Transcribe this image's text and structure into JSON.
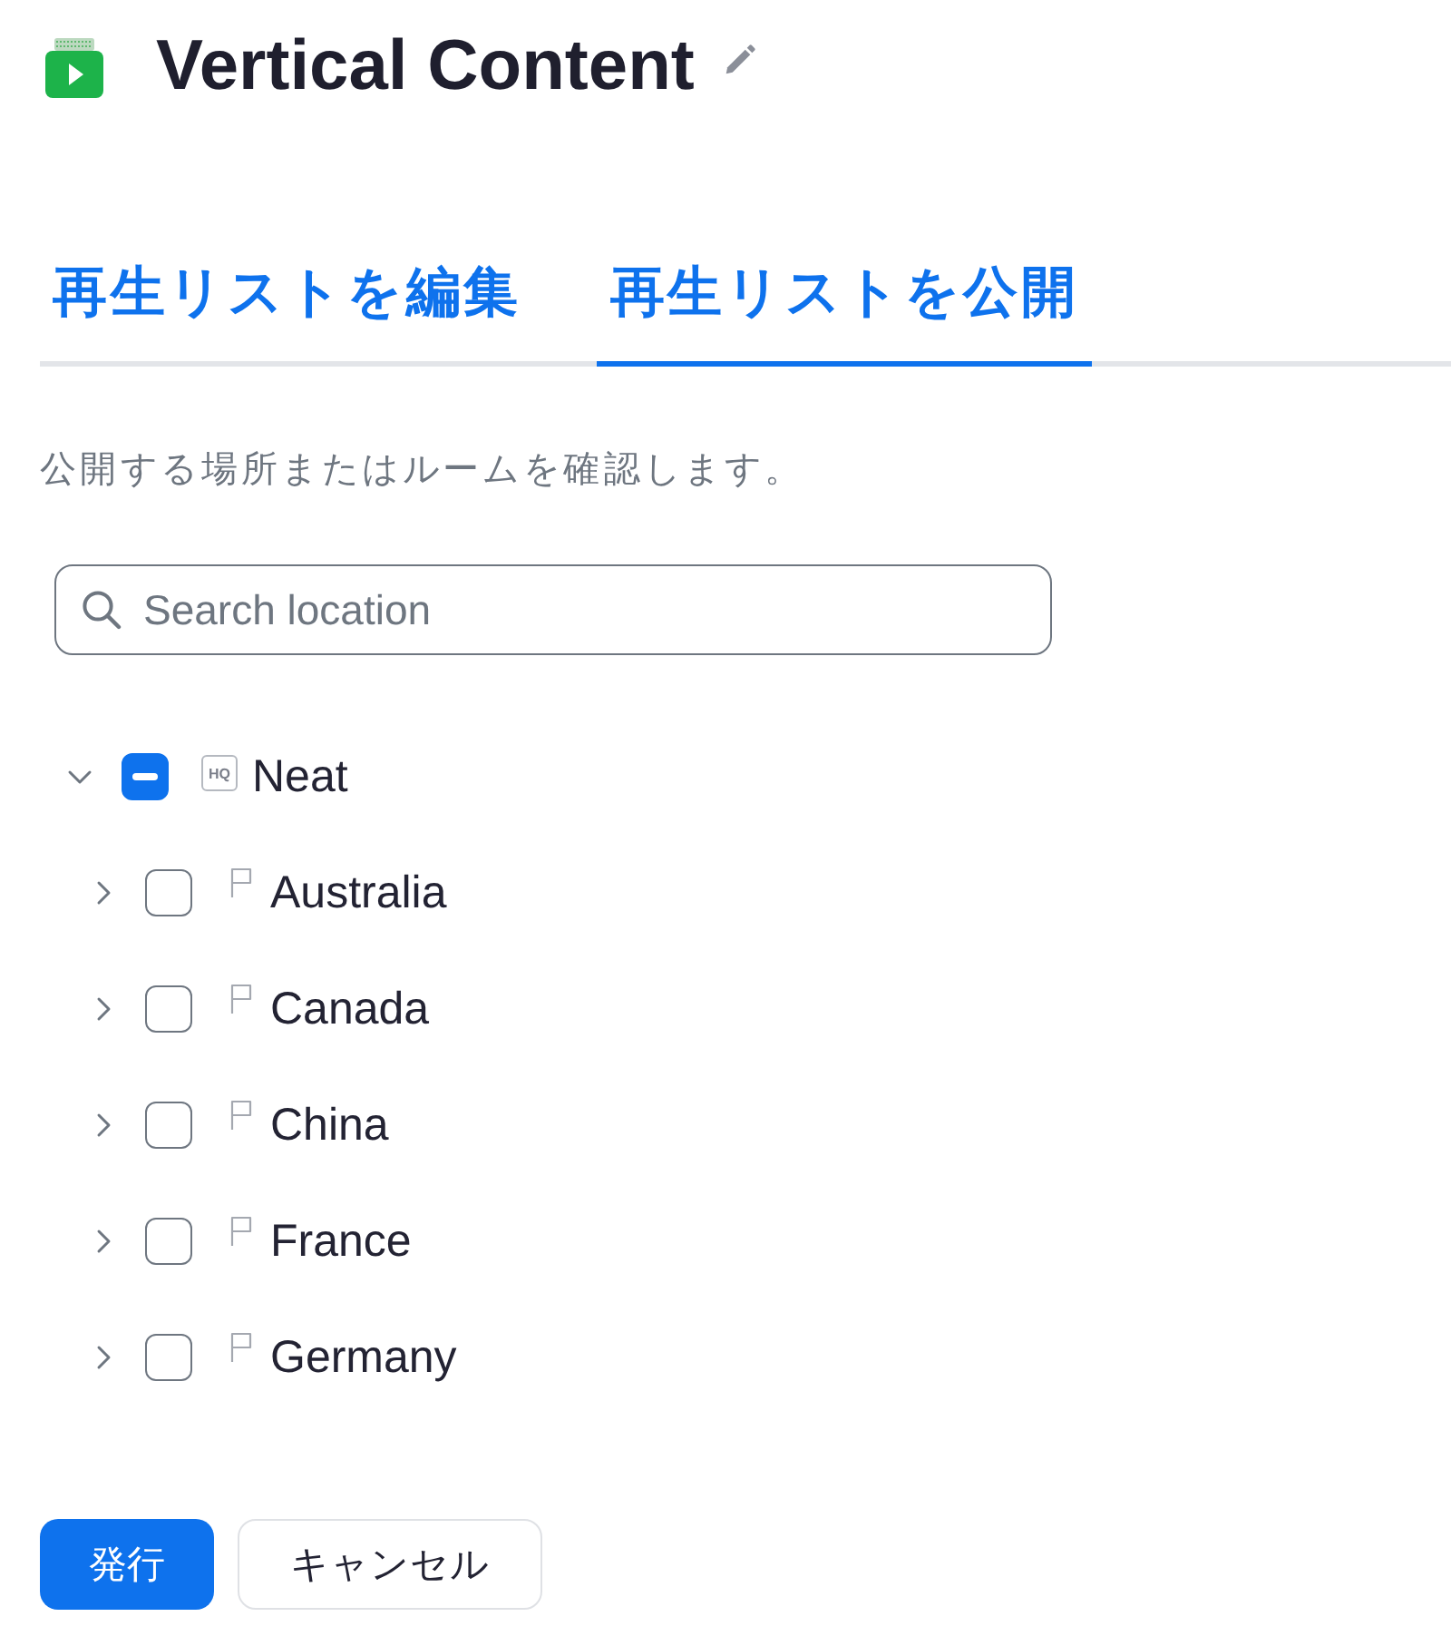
{
  "header": {
    "title": "Vertical Content"
  },
  "tabs": [
    {
      "label": "再生リストを編集",
      "selected": false
    },
    {
      "label": "再生リストを公開",
      "selected": true
    }
  ],
  "description": "公開する場所またはルームを確認します。",
  "search": {
    "placeholder": "Search location"
  },
  "tree": [
    {
      "label": "Neat",
      "badge": "HQ",
      "expanded": true,
      "checked": true,
      "indeterminate": true,
      "children": [
        {
          "label": "Australia",
          "expanded": false,
          "checked": false,
          "indeterminate": false
        },
        {
          "label": "Canada",
          "expanded": false,
          "checked": false,
          "indeterminate": false
        },
        {
          "label": "China",
          "expanded": false,
          "checked": false,
          "indeterminate": false
        },
        {
          "label": "France",
          "expanded": false,
          "checked": false,
          "indeterminate": false
        },
        {
          "label": "Germany",
          "expanded": false,
          "checked": false,
          "indeterminate": false
        }
      ]
    }
  ],
  "buttons": [
    {
      "label": "発行",
      "kind": "primary"
    },
    {
      "label": "キャンセル",
      "kind": "secondary"
    }
  ]
}
